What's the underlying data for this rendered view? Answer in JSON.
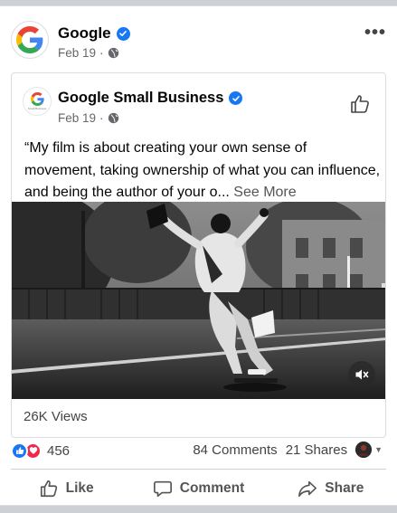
{
  "post": {
    "page_name": "Google",
    "date": "Feb 19",
    "separator": "·",
    "more_label": "•••"
  },
  "shared_post": {
    "page_name": "Google Small Business",
    "avatar_caption": "Small Business",
    "date": "Feb 19",
    "separator": "·",
    "text": "“My film is about creating your own sense of movement, taking ownership of what you can influence, and being the author of your o...",
    "see_more": "See More",
    "views": "26K Views"
  },
  "reactions": {
    "count": "456",
    "comments": "84 Comments",
    "shares": "21 Shares"
  },
  "actions": {
    "like": "Like",
    "comment": "Comment",
    "share": "Share"
  },
  "icons": {
    "avatar": "google-logo-icon",
    "verified": "verified-badge-icon",
    "audience": "globe-icon",
    "mute": "muted-speaker-icon"
  },
  "colors": {
    "facebook_blue": "#1877f2",
    "love_red": "#f02849",
    "secondary_text": "#65676b"
  }
}
